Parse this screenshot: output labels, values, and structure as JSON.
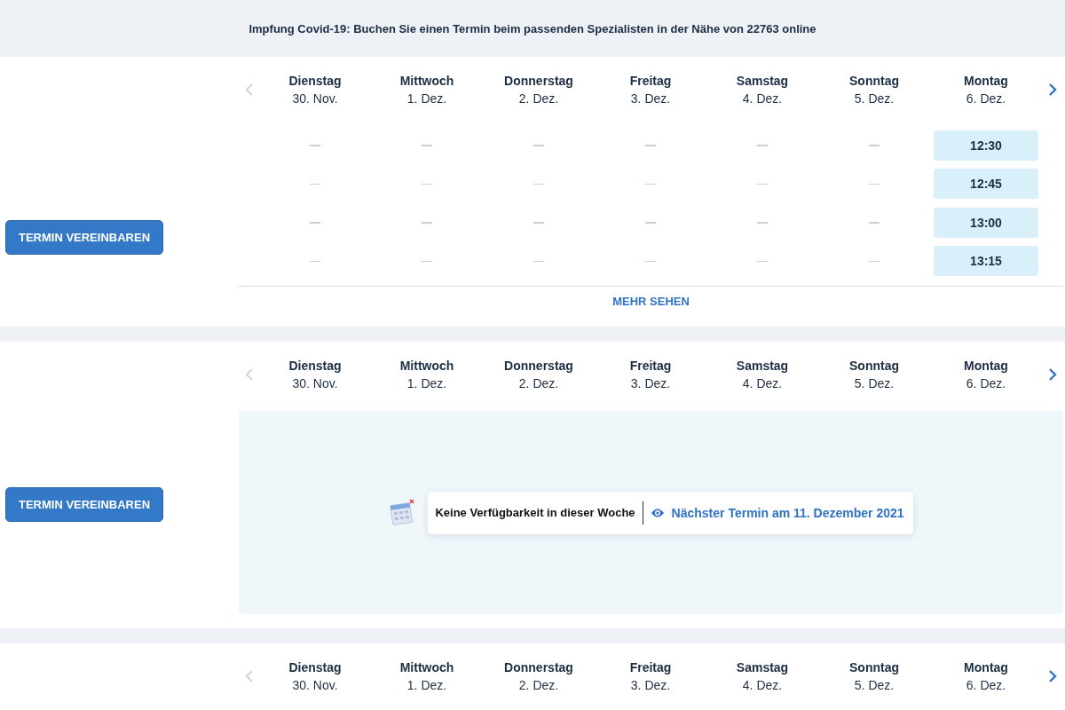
{
  "banner": {
    "text": "Impfung Covid-19: Buchen Sie einen Termin beim passenden Spezialisten in der Nähe von 22763 online"
  },
  "practices": [
    {
      "kind": "slots",
      "button": "TERMIN VEREINBAREN",
      "previous_disabled": true,
      "next_disabled": false,
      "days": [
        {
          "weekday": "Dienstag",
          "date": "30. Nov."
        },
        {
          "weekday": "Mittwoch",
          "date": "1. Dez."
        },
        {
          "weekday": "Donnerstag",
          "date": "2. Dez."
        },
        {
          "weekday": "Freitag",
          "date": "3. Dez."
        },
        {
          "weekday": "Samstag",
          "date": "4. Dez."
        },
        {
          "weekday": "Sonntag",
          "date": "5. Dez."
        },
        {
          "weekday": "Montag",
          "date": "6. Dez.",
          "slots": [
            "12:30",
            "12:45",
            "13:00",
            "13:15"
          ]
        }
      ],
      "more": "MEHR SEHEN"
    },
    {
      "kind": "unavailable",
      "button": "TERMIN VEREINBAREN",
      "previous_disabled": true,
      "next_disabled": false,
      "days": [
        {
          "weekday": "Dienstag",
          "date": "30. Nov."
        },
        {
          "weekday": "Mittwoch",
          "date": "1. Dez."
        },
        {
          "weekday": "Donnerstag",
          "date": "2. Dez."
        },
        {
          "weekday": "Freitag",
          "date": "3. Dez."
        },
        {
          "weekday": "Samstag",
          "date": "4. Dez."
        },
        {
          "weekday": "Sonntag",
          "date": "5. Dez."
        },
        {
          "weekday": "Montag",
          "date": "6. Dez."
        }
      ],
      "notice": "Keine Verfügbarkeit in dieser Woche",
      "next_link": "Nächster Termin am 11. Dezember 2021"
    },
    {
      "kind": "cut",
      "previous_disabled": true,
      "next_disabled": false,
      "days": [
        {
          "weekday": "Dienstag",
          "date": "30. Nov."
        },
        {
          "weekday": "Mittwoch",
          "date": "1. Dez."
        },
        {
          "weekday": "Donnerstag",
          "date": "2. Dez."
        },
        {
          "weekday": "Freitag",
          "date": "3. Dez."
        },
        {
          "weekday": "Samstag",
          "date": "4. Dez."
        },
        {
          "weekday": "Sonntag",
          "date": "5. Dez."
        },
        {
          "weekday": "Montag",
          "date": "6. Dez."
        }
      ]
    }
  ]
}
